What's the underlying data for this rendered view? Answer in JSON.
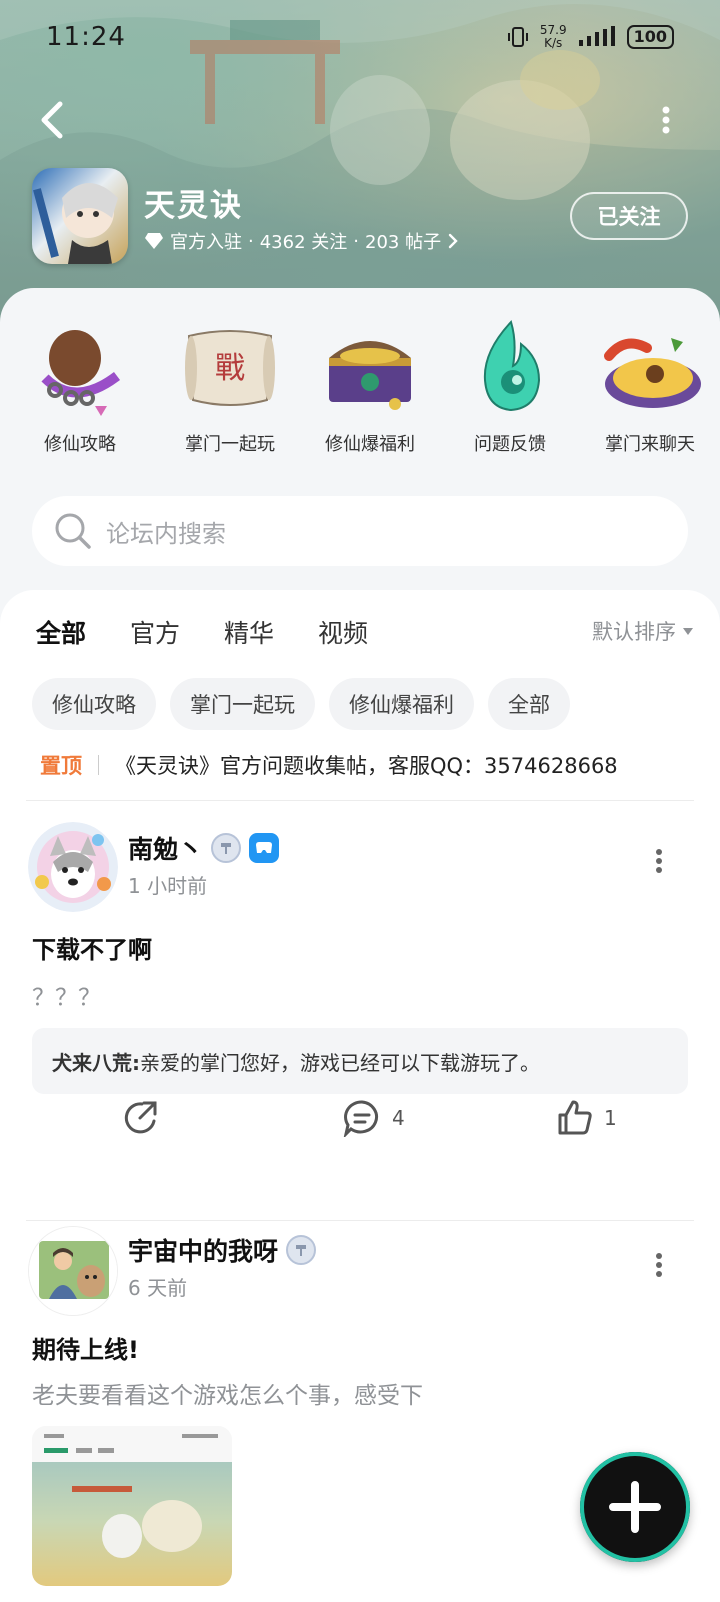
{
  "status_bar": {
    "time": "11:24",
    "net_speed_value": "57.9",
    "net_speed_unit": "K/s",
    "battery": "100"
  },
  "header": {
    "title": "天灵诀",
    "meta_verified": "官方入驻",
    "meta_follows": "4362 关注",
    "meta_posts": "203 帖子",
    "follow_label": "已关注"
  },
  "categories": [
    {
      "label": "修仙攻略",
      "icon": "scroll-bag-icon"
    },
    {
      "label": "掌门一起玩",
      "icon": "battle-scroll-icon"
    },
    {
      "label": "修仙爆福利",
      "icon": "treasure-chest-icon"
    },
    {
      "label": "问题反馈",
      "icon": "spirit-flame-icon"
    },
    {
      "label": "掌门来聊天",
      "icon": "food-plate-icon"
    }
  ],
  "search": {
    "placeholder": "论坛内搜索"
  },
  "tabs": [
    "全部",
    "官方",
    "精华",
    "视频"
  ],
  "sort_label": "默认排序",
  "chips": [
    "修仙攻略",
    "掌门一起玩",
    "修仙爆福利",
    "全部"
  ],
  "pinned": {
    "badge": "置顶",
    "text": "《天灵诀》官方问题收集帖，客服QQ：3574628668"
  },
  "posts": [
    {
      "author": "南勉丶",
      "time": "1 小时前",
      "title": "下载不了啊",
      "body": "？？？",
      "reply_name": "犬来八荒:",
      "reply_text": "亲爱的掌门您好，游戏已经可以下载游玩了。",
      "comments": "4",
      "likes": "1"
    },
    {
      "author": "宇宙中的我呀",
      "time": "6 天前",
      "title": "期待上线!",
      "body": "老夫要看看这个游戏怎么个事，感受下"
    }
  ],
  "colors": {
    "accent": "#22c1a4",
    "pin": "#f07a3a"
  }
}
